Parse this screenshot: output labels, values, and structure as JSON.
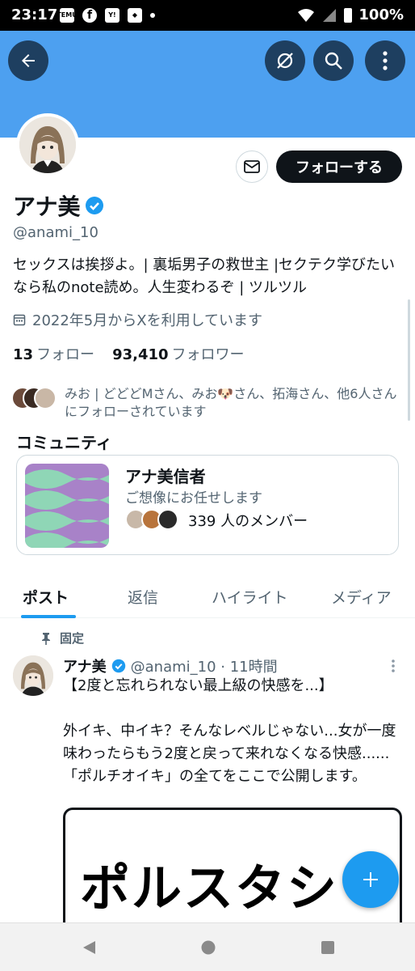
{
  "status_bar": {
    "time": "23:17",
    "apps": [
      "temu",
      "facebook",
      "yahoo",
      "notification",
      "dot"
    ],
    "battery": "100%"
  },
  "header": {
    "back_icon": "arrow-left-icon",
    "actions": [
      "no-cloud-icon",
      "search-icon",
      "more-vertical-icon"
    ]
  },
  "profile": {
    "name": "アナ美",
    "handle": "@anami_10",
    "bio": "セックスは挨拶よ。| 裏垢男子の救世主 |セクテク学びたいなら私のnote読め。人生変わるぞ | ツルツル",
    "joined": "2022年5月からXを利用しています",
    "following_count": "13",
    "following_label": "フォロー",
    "followers_count": "93,410",
    "followers_label": "フォロワー",
    "followed_by": "みお | どどどMさん、みお🐶さん、拓海さん、他6人さんにフォローされています",
    "follow_button": "フォローする",
    "colors": {
      "accent": "#1d9bf0",
      "banner": "#4da0f0"
    }
  },
  "community": {
    "section_title": "コミュニティ",
    "name": "アナ美信者",
    "description": "ご想像にお任せします",
    "members": "339 人のメンバー"
  },
  "tabs": [
    {
      "label": "ポスト"
    },
    {
      "label": "返信"
    },
    {
      "label": "ハイライト"
    },
    {
      "label": "メディア"
    }
  ],
  "post": {
    "pinned_label": "固定",
    "author": "アナ美",
    "meta": "@anami_10 · 11時間",
    "body": "【2度と忘れられない最上級の快感を...】\n\n外イキ、中イキ？そんなレベルじゃない...女が一度味わったらもう2度と戻って来れなくなる快感......「ポルチオイキ」の全てをここで公開します。",
    "media_text": "ポルスタシ"
  }
}
